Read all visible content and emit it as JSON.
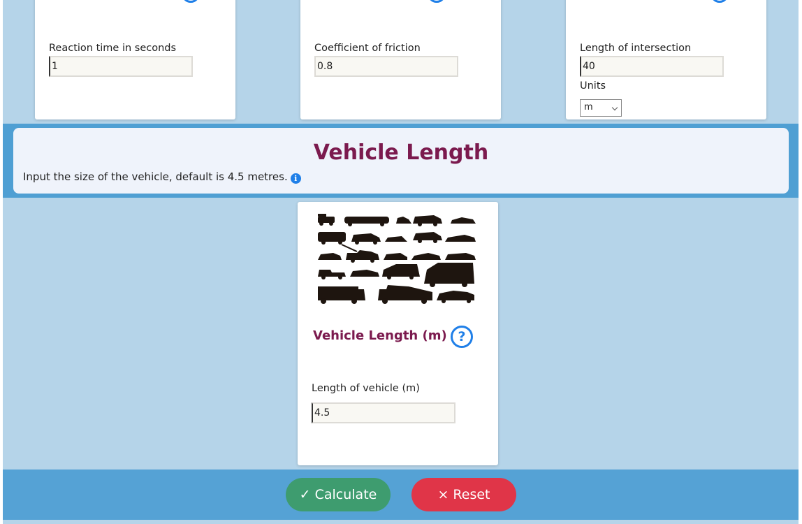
{
  "top_cards": [
    {
      "label": "Reaction time in seconds",
      "value": "1"
    },
    {
      "label": "Coefficient of friction",
      "value": "0.8"
    },
    {
      "label": "Length of intersection",
      "value": "40",
      "units_label": "Units",
      "units_value": "m"
    }
  ],
  "section": {
    "title": "Vehicle Length",
    "description": "Input the size of the vehicle, default is 4.5 metres.",
    "info_icon": "i"
  },
  "vehicle_card": {
    "image": "vehicle-silhouettes-image",
    "title": "Vehicle Length (m)",
    "help_icon": "?",
    "field_label": "Length of vehicle (m)",
    "field_value": "4.5"
  },
  "footer": {
    "calculate_label": "✓ Calculate",
    "reset_label": "× Reset"
  },
  "colors": {
    "accent_title": "#7b1a4e",
    "help_blue": "#1f7fe8",
    "calculate_green": "#3e9c6f",
    "reset_red": "#e03548",
    "band_blue": "#4f9fd3",
    "page_bg": "#b5d4e9"
  }
}
